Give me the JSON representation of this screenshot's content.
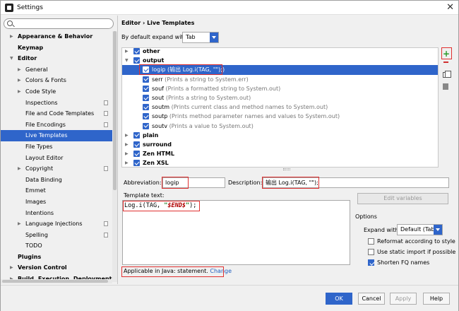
{
  "window": {
    "title": "Settings"
  },
  "sidebar": {
    "search_placeholder": "",
    "items": [
      {
        "label": "Appearance & Behavior",
        "bold": true,
        "arrow": "▶",
        "indent": 1
      },
      {
        "label": "Keymap",
        "bold": true,
        "arrow": "",
        "indent": 1
      },
      {
        "label": "Editor",
        "bold": true,
        "arrow": "▼",
        "indent": 1
      },
      {
        "label": "General",
        "arrow": "▶",
        "indent": 2
      },
      {
        "label": "Colors & Fonts",
        "arrow": "▶",
        "indent": 2
      },
      {
        "label": "Code Style",
        "arrow": "▶",
        "indent": 2
      },
      {
        "label": "Inspections",
        "indent": 2,
        "page": true
      },
      {
        "label": "File and Code Templates",
        "indent": 2,
        "page": true
      },
      {
        "label": "File Encodings",
        "indent": 2,
        "page": true
      },
      {
        "label": "Live Templates",
        "indent": 2,
        "selected": true
      },
      {
        "label": "File Types",
        "indent": 2
      },
      {
        "label": "Layout Editor",
        "indent": 2
      },
      {
        "label": "Copyright",
        "arrow": "▶",
        "indent": 2,
        "page": true
      },
      {
        "label": "Data Binding",
        "indent": 2
      },
      {
        "label": "Emmet",
        "indent": 2
      },
      {
        "label": "Images",
        "indent": 2
      },
      {
        "label": "Intentions",
        "indent": 2
      },
      {
        "label": "Language Injections",
        "arrow": "▶",
        "indent": 2,
        "page": true
      },
      {
        "label": "Spelling",
        "indent": 2,
        "page": true
      },
      {
        "label": "TODO",
        "indent": 2
      },
      {
        "label": "Plugins",
        "bold": true,
        "indent": 1
      },
      {
        "label": "Version Control",
        "bold": true,
        "arrow": "▶",
        "indent": 1
      },
      {
        "label": "Build, Execution, Deployment",
        "bold": true,
        "arrow": "▶",
        "indent": 1
      }
    ]
  },
  "breadcrumb": "Editor › Live Templates",
  "expand": {
    "label": "By default expand with",
    "value": "Tab"
  },
  "templates": [
    {
      "abbr": "other",
      "group": true,
      "arrow": "▶"
    },
    {
      "abbr": "output",
      "group": true,
      "arrow": "▼"
    },
    {
      "abbr": "logip",
      "desc": "(输出 Log.i(TAG, \"\");)",
      "selected": true
    },
    {
      "abbr": "serr",
      "desc": "(Prints a string to System.err)"
    },
    {
      "abbr": "souf",
      "desc": "(Prints a formatted string to System.out)"
    },
    {
      "abbr": "sout",
      "desc": "(Prints a string to System.out)"
    },
    {
      "abbr": "soutm",
      "desc": "(Prints current class and method names to System.out)"
    },
    {
      "abbr": "soutp",
      "desc": "(Prints method parameter names and values to System.out)"
    },
    {
      "abbr": "soutv",
      "desc": "(Prints a value to System.out)"
    },
    {
      "abbr": "plain",
      "group": true,
      "arrow": "▶"
    },
    {
      "abbr": "surround",
      "group": true,
      "arrow": "▶"
    },
    {
      "abbr": "Zen HTML",
      "group": true,
      "arrow": "▶"
    },
    {
      "abbr": "Zen XSL",
      "group": true,
      "arrow": "▶"
    }
  ],
  "editor": {
    "abbreviation_label": "Abbreviation:",
    "abbreviation_value": "logip",
    "description_label": "Description:",
    "description_value": "输出 Log.i(TAG, \"\");",
    "template_text_label": "Template text:",
    "code_prefix": "Log.i(TAG, ",
    "code_q1": "\"",
    "code_var": "$END$",
    "code_q2": "\"",
    "code_suffix": ");",
    "edit_variables": "Edit variables",
    "applicable": "Applicable in Java: statement.",
    "change": "Change"
  },
  "options": {
    "title": "Options",
    "expand_label": "Expand with",
    "expand_value": "Default (Tab)",
    "reformat": "Reformat according to style",
    "static_import": "Use static import if possible",
    "shorten": "Shorten FQ names",
    "reformat_checked": false,
    "static_checked": false,
    "shorten_checked": true
  },
  "footer": {
    "ok": "OK",
    "cancel": "Cancel",
    "apply": "Apply",
    "help": "Help"
  },
  "colors": {
    "accent": "#2f65ca",
    "highlight": "#e03030",
    "add": "#2a9a2a"
  }
}
